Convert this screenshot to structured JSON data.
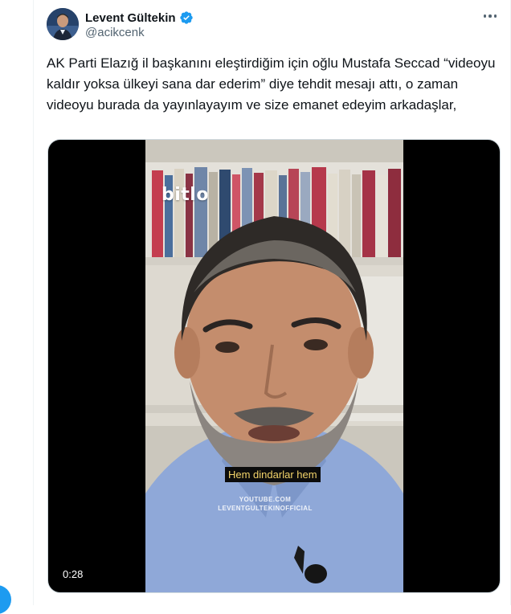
{
  "tweet": {
    "display_name": "Levent Gültekin",
    "handle": "@acikcenk",
    "text": "AK Parti Elazığ il başkanını eleştirdiğim için oğlu Mustafa Seccad “videoyu kaldır yoksa ülkeyi sana dar ederim” diye tehdit mesajı attı, o zaman videoyu burada da yayınlayayım ve size emanet edeyim arkadaşlar,",
    "more_icon": "more-horizontal-icon",
    "verified_icon": "verified-badge-icon",
    "verified_color": "#1d9bf0"
  },
  "video": {
    "watermark": "bitlo",
    "subtitle": "Hem dindarlar hem",
    "channel_line1": "YOUTUBE.COM",
    "channel_line2": "LEVENTGULTEKINOFFICIAL",
    "duration": "0:28"
  }
}
